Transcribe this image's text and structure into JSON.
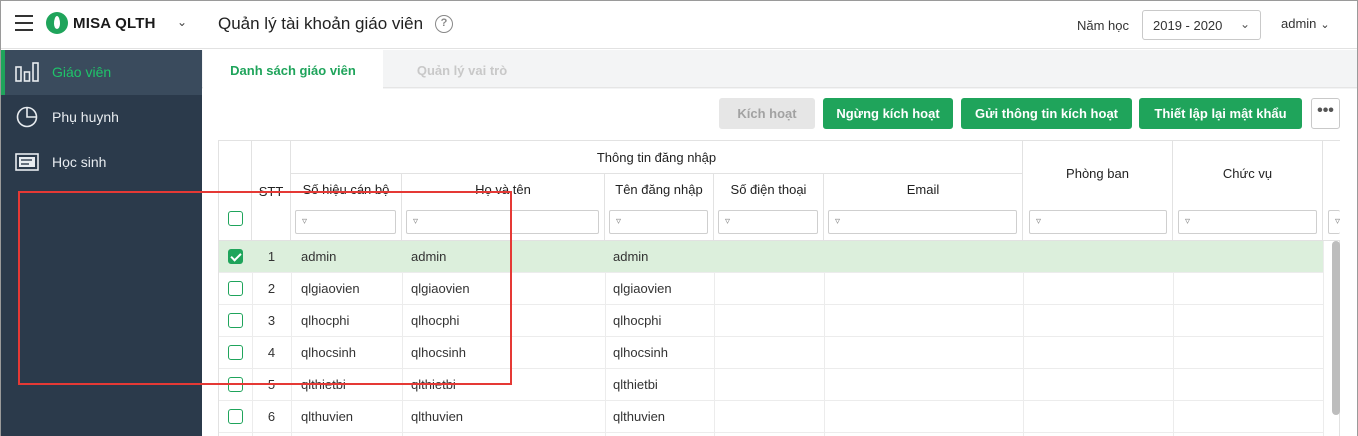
{
  "header": {
    "brand": "MISA QLTH",
    "page_title": "Quản lý tài khoản giáo viên",
    "help_symbol": "?",
    "year_label": "Năm học",
    "year_value": "2019 - 2020",
    "user": "admin"
  },
  "sidebar": {
    "items": [
      {
        "label": "Giáo viên",
        "icon": "bar-chart-icon",
        "active": true
      },
      {
        "label": "Phụ huynh",
        "icon": "pie-chart-icon",
        "active": false
      },
      {
        "label": "Học sinh",
        "icon": "id-card-icon",
        "active": false
      }
    ]
  },
  "tabs": [
    {
      "label": "Danh sách giáo viên",
      "active": true
    },
    {
      "label": "Quản lý vai trò",
      "active": false
    }
  ],
  "toolbar": {
    "activate": "Kích hoạt",
    "stop_activate": "Ngừng kích hoạt",
    "send_info": "Gửi thông tin kích hoạt",
    "reset_password": "Thiết lập lại mật khẩu",
    "more": "•••"
  },
  "table": {
    "group_header": "Thông tin đăng nhập",
    "columns": {
      "stt": "STT",
      "code": "Số hiệu cán bộ",
      "name": "Họ và tên",
      "username": "Tên đăng nhập",
      "phone": "Số điện thoại",
      "email": "Email",
      "department": "Phòng ban",
      "position": "Chức vụ"
    },
    "filter_icon": "filter-icon",
    "rows": [
      {
        "stt": "1",
        "code": "admin",
        "name": "admin",
        "username": "admin",
        "checked": true
      },
      {
        "stt": "2",
        "code": "qlgiaovien",
        "name": "qlgiaovien",
        "username": "qlgiaovien",
        "checked": false
      },
      {
        "stt": "3",
        "code": "qlhocphi",
        "name": "qlhocphi",
        "username": "qlhocphi",
        "checked": false
      },
      {
        "stt": "4",
        "code": "qlhocsinh",
        "name": "qlhocsinh",
        "username": "qlhocsinh",
        "checked": false
      },
      {
        "stt": "5",
        "code": "qlthietbi",
        "name": "qlthietbi",
        "username": "qlthietbi",
        "checked": false
      },
      {
        "stt": "6",
        "code": "qlthuvien",
        "name": "qlthuvien",
        "username": "qlthuvien",
        "checked": false
      }
    ]
  },
  "colors": {
    "accent": "#1fa45b",
    "sidebar": "#2b3a4b",
    "highlight": "#e53935",
    "selected_row": "#dcefdc"
  }
}
